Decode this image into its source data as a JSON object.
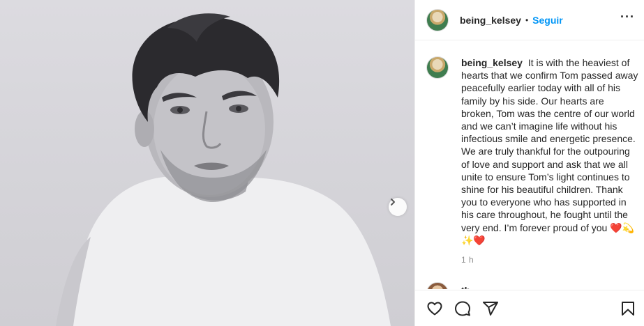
{
  "post": {
    "author": "being_kelsey",
    "separator": "•",
    "follow_label": "Seguir",
    "more_label": "···",
    "caption": "It is with the heaviest of hearts that we confirm Tom passed away peacefully earlier today with all of his family by his side. Our hearts are broken, Tom was the centre of our world and we can’t imagine life without his infectious smile and energetic presence. We are truly thankful for the outpouring of love and support and ask that we all unite to ensure Tom’s light continues to shine for his beautiful children. Thank you to everyone who has supported in his care throughout, he fought until the very end. I’m forever proud of you ❤️💫✨❤️",
    "time": "1 h",
    "next_comment_partial": "th"
  },
  "icons": {
    "next": "chevron-right-icon",
    "like": "heart-icon",
    "comment": "comment-bubble-icon",
    "share": "paper-plane-icon",
    "save": "bookmark-icon"
  },
  "colors": {
    "accent": "#0095f6",
    "text": "#262626",
    "muted": "#8e8e8e",
    "border": "#efefef"
  }
}
